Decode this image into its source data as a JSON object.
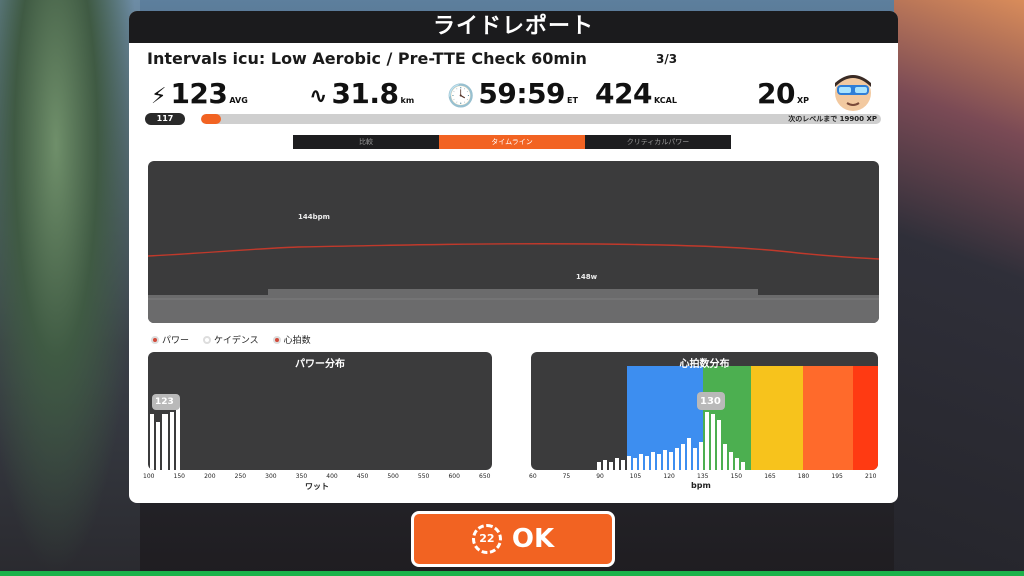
{
  "header": {
    "title": "ライドレポート"
  },
  "workout": {
    "name": "Intervals icu: Low Aerobic / Pre-TTE Check 60min",
    "progress": "3/3"
  },
  "stats": {
    "power": {
      "icon": "lightning-icon",
      "value": "123",
      "unit": "AVG"
    },
    "distance": {
      "icon": "distance-icon",
      "value": "31.8",
      "unit": "km"
    },
    "time": {
      "icon": "clock-icon",
      "value": "59:59",
      "unit": "ET"
    },
    "calories": {
      "value": "424",
      "unit": "KCAL"
    },
    "xp": {
      "value": "20",
      "unit": "XP"
    }
  },
  "level": {
    "badge": "117"
  },
  "xp_bar": {
    "progress": 0.03,
    "text": "次のレベルまで 19900 XP"
  },
  "tabs": [
    {
      "label": "比較",
      "active": false
    },
    {
      "label": "タイムライン",
      "active": true
    },
    {
      "label": "クリティカルパワー",
      "active": false
    }
  ],
  "timeline": {
    "hr_label": "144bpm",
    "power_label": "148w"
  },
  "legend": {
    "power": "パワー",
    "cadence": "ケイデンス",
    "hr": "心拍数"
  },
  "power_hist": {
    "title": "パワー分布",
    "axis_title": "ワット",
    "ticks": [
      "100",
      "150",
      "200",
      "250",
      "300",
      "350",
      "400",
      "450",
      "500",
      "550",
      "600",
      "650"
    ],
    "marker": "123"
  },
  "hr_hist": {
    "title": "心拍数分布",
    "axis_title": "bpm",
    "ticks": [
      "60",
      "75",
      "90",
      "105",
      "120",
      "135",
      "150",
      "165",
      "180",
      "195",
      "210"
    ],
    "marker": "130"
  },
  "ok_button": {
    "countdown": "22",
    "label": "OK"
  },
  "colors": {
    "accent": "#f26322",
    "zone_blue": "#3d8ef0",
    "zone_green": "#4caf50",
    "zone_yellow": "#f7c31c",
    "zone_orange": "#ff6a2b",
    "zone_red": "#ff3a12",
    "hr_line": "#c0392b"
  }
}
